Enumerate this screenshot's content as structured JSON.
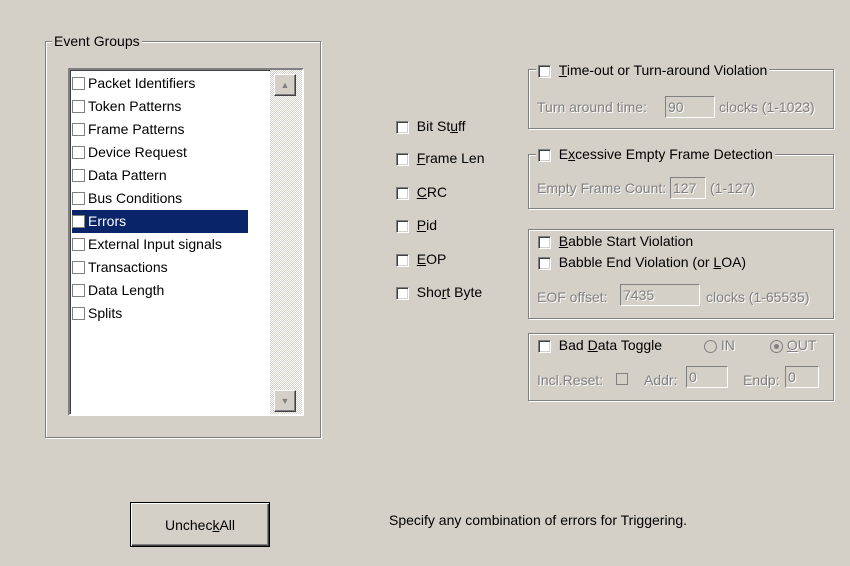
{
  "event_groups": {
    "title": "Event Groups",
    "items": [
      {
        "label": "Packet Identifiers",
        "checked": false
      },
      {
        "label": "Token Patterns",
        "checked": false
      },
      {
        "label": "Frame Patterns",
        "checked": false
      },
      {
        "label": "Device Request",
        "checked": false
      },
      {
        "label": "Data Pattern",
        "checked": false
      },
      {
        "label": "Bus Conditions",
        "checked": false
      },
      {
        "label": "Errors",
        "checked": false,
        "selected": true
      },
      {
        "label": "External Input signals",
        "checked": false
      },
      {
        "label": "Transactions",
        "checked": false
      },
      {
        "label": "Data Length",
        "checked": false
      },
      {
        "label": "Splits",
        "checked": false
      }
    ]
  },
  "error_checks": {
    "bit_stuff": {
      "pre": "Bit St",
      "mn": "u",
      "post": "ff"
    },
    "frame_len": {
      "pre": "",
      "mn": "F",
      "post": "rame Len"
    },
    "crc": {
      "pre": "",
      "mn": "C",
      "post": "RC"
    },
    "pid": {
      "pre": "",
      "mn": "P",
      "post": "id"
    },
    "eop": {
      "pre": "",
      "mn": "E",
      "post": "OP"
    },
    "short_byte": {
      "pre": "Sho",
      "mn": "r",
      "post": "t Byte"
    }
  },
  "timeout": {
    "label": {
      "pre": "",
      "mn": "T",
      "post": "ime-out or Turn-around Violation"
    },
    "field_label": "Turn around time:",
    "value": "90",
    "units": "clocks (1-1023)"
  },
  "empty_frame": {
    "label": {
      "pre": "E",
      "mn": "x",
      "post": "cessive Empty Frame Detection"
    },
    "field_label": "Empty Frame Count:",
    "value": "127",
    "units": "(1-127)"
  },
  "babble": {
    "start": {
      "pre": "",
      "mn": "B",
      "post": "abble Start Violation"
    },
    "end": {
      "pre": "Babble End Violation (or ",
      "mn": "L",
      "post": "OA)"
    },
    "field_label": "EOF offset:",
    "value": "7435",
    "units": "clocks (1-65535)"
  },
  "bad_data": {
    "label": {
      "pre": "Bad ",
      "mn": "D",
      "post": "ata Toggle"
    },
    "in_label": "IN",
    "out_label": {
      "pre": "",
      "mn": "O",
      "post": "UT"
    },
    "selected": "OUT",
    "incl_reset": "Incl.Reset:",
    "addr_label": "Addr:",
    "addr_value": "0",
    "endp_label": "Endp:",
    "endp_value": "0"
  },
  "uncheck_button": {
    "pre": "Unchec",
    "mn": "k",
    "post": " All"
  },
  "hint": "Specify any combination of errors for Triggering."
}
